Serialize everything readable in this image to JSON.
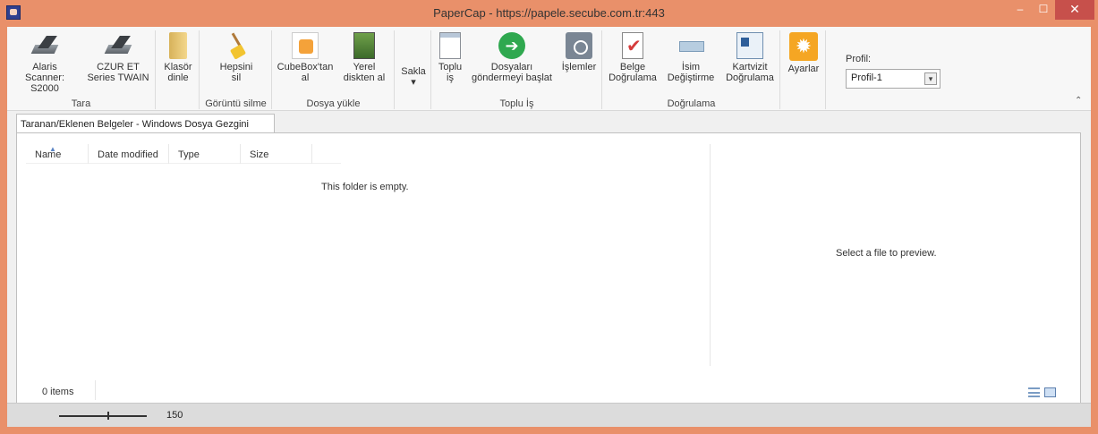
{
  "window": {
    "title": "PaperCap - https://papele.secube.com.tr:443",
    "minimize": "–",
    "maximize": "☐",
    "close": "✕"
  },
  "ribbon": {
    "groups": [
      {
        "label": "Tara",
        "buttons": [
          {
            "label": "Alaris\nScanner: S2000",
            "icon": "scanner-icon"
          },
          {
            "label": "CZUR ET\nSeries TWAIN",
            "icon": "scanner-icon"
          }
        ]
      },
      {
        "label": "",
        "buttons": [
          {
            "label": "Klasör\ndinle",
            "icon": "folder-icon"
          }
        ]
      },
      {
        "label": "Görüntü silme",
        "buttons": [
          {
            "label": "Hepsini\nsil",
            "icon": "broom-icon"
          }
        ]
      },
      {
        "label": "Dosya yükle",
        "buttons": [
          {
            "label": "CubeBox'tan\nal",
            "icon": "cubebox-icon"
          },
          {
            "label": "Yerel\ndiskten al",
            "icon": "local-disk-icon"
          }
        ]
      },
      {
        "label": "",
        "buttons": [
          {
            "label": "Sakla\n▾",
            "icon": ""
          }
        ]
      },
      {
        "label": "Toplu İş",
        "buttons": [
          {
            "label": "Toplu\niş",
            "icon": "batch-icon"
          },
          {
            "label": "Dosyaları\ngöndermeyi başlat",
            "icon": "send-arrow-icon"
          },
          {
            "label": "İşlemler",
            "icon": "jobs-icon"
          }
        ]
      },
      {
        "label": "Doğrulama",
        "buttons": [
          {
            "label": "Belge\nDoğrulama",
            "icon": "document-check-icon"
          },
          {
            "label": "İsim\nDeğiştirme",
            "icon": "rename-icon"
          },
          {
            "label": "Kartvizit\nDoğrulama",
            "icon": "business-card-icon"
          }
        ]
      },
      {
        "label": "",
        "buttons": [
          {
            "label": "Ayarlar",
            "icon": "settings-gear-icon"
          }
        ]
      }
    ],
    "profile": {
      "label": "Profil:",
      "selected": "Profil-1"
    },
    "collapse": "⌃"
  },
  "tab": {
    "label": "Taranan/Eklenen Belgeler - Windows Dosya Gezgini"
  },
  "explorer": {
    "columns": [
      "Name",
      "Date modified",
      "Type",
      "Size"
    ],
    "empty_message": "This folder is empty.",
    "preview_message": "Select a file to preview.",
    "item_count": "0 items"
  },
  "zoom": {
    "value": "150"
  }
}
